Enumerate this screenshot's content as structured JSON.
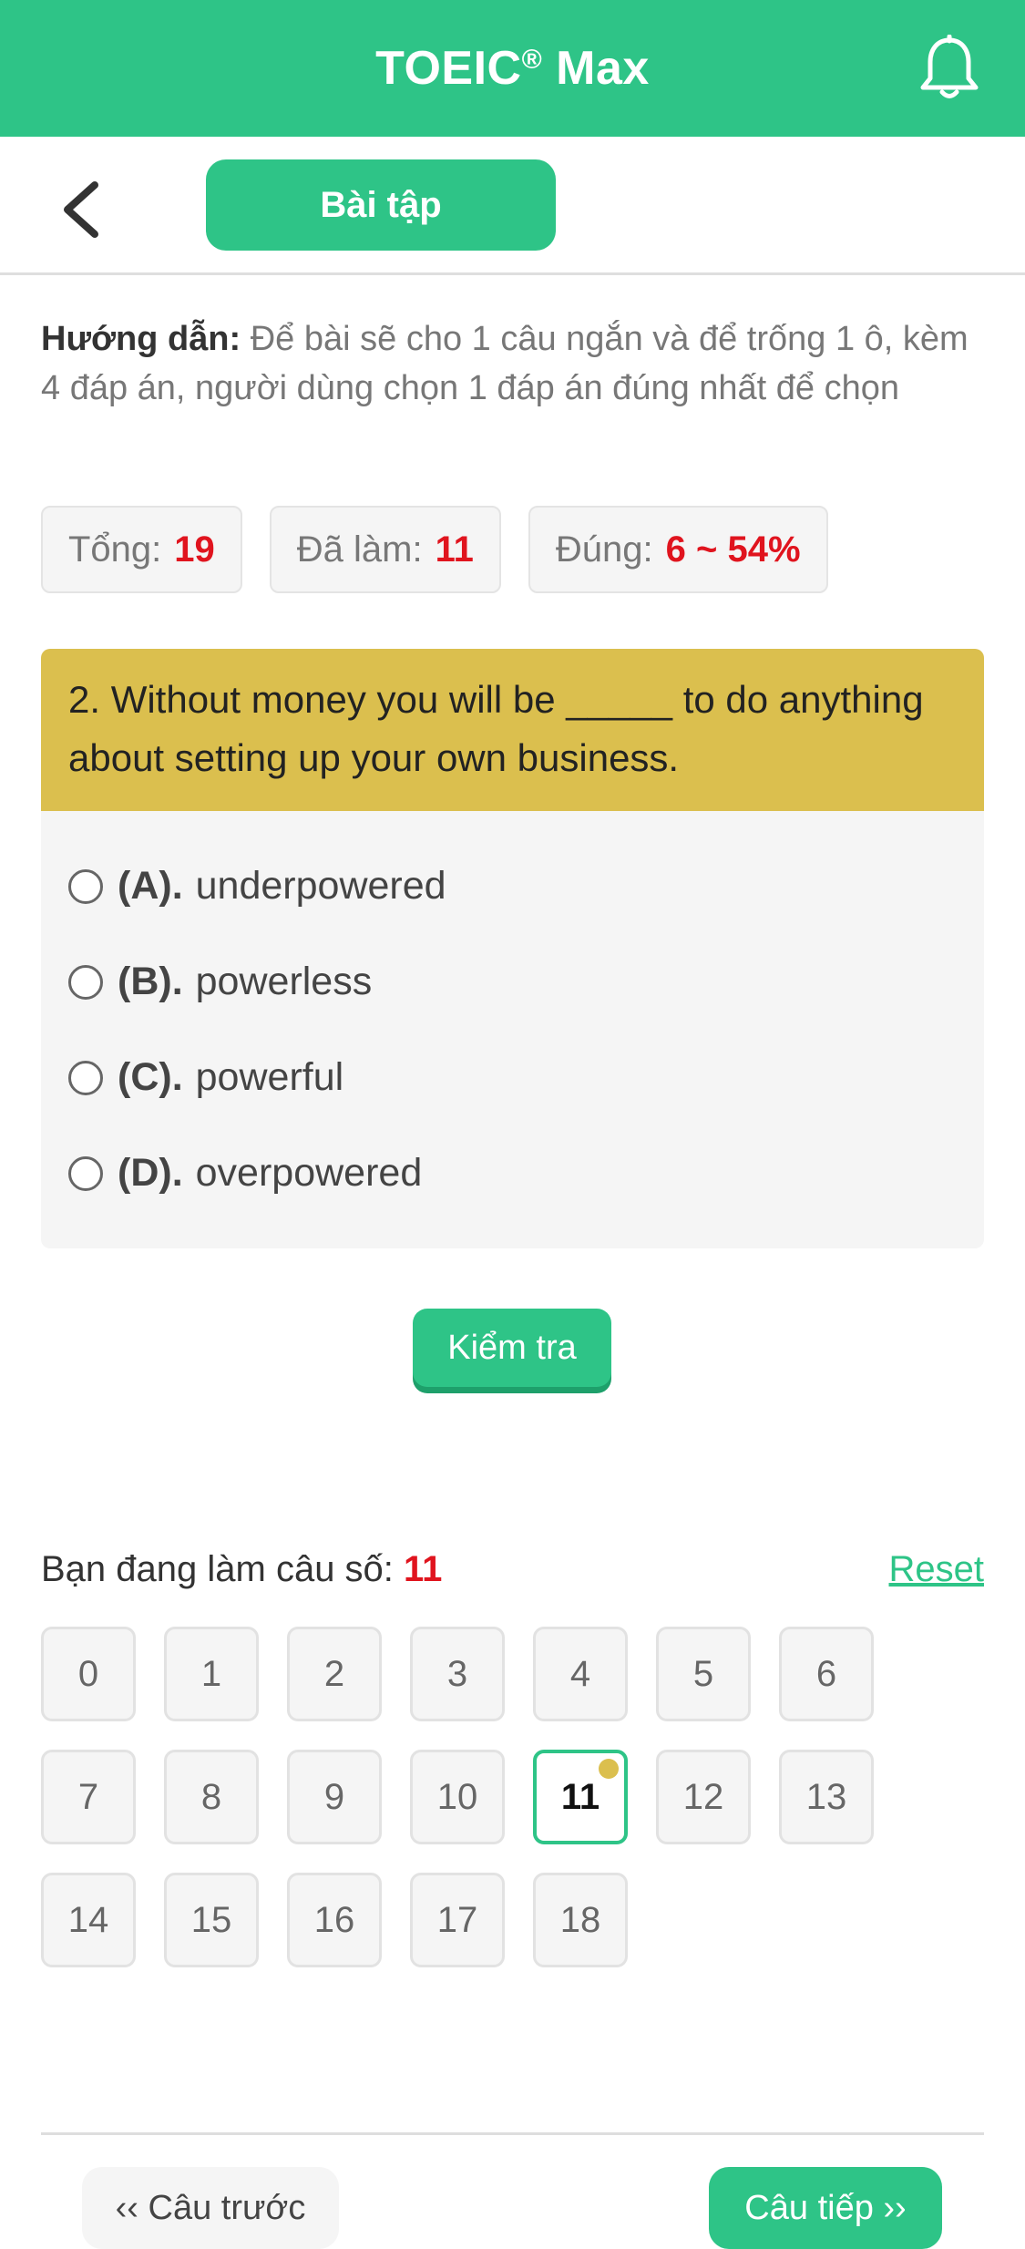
{
  "header": {
    "title": "TOEIC",
    "title_mark": "®",
    "title_suffix": " Max",
    "bell_icon": "bell-icon",
    "brand_color": "#2ec487"
  },
  "subbar": {
    "back_icon": "chevron-left-icon",
    "tab_label": "Bài tập"
  },
  "instructions": {
    "label": "Hướng dẫn:",
    "text": " Để bài sẽ cho 1 câu ngắn và để trống 1 ô, kèm 4 đáp án, người dùng chọn 1 đáp án đúng nhất để chọn"
  },
  "stats": [
    {
      "label": "Tổng:",
      "value": "19"
    },
    {
      "label": "Đã làm:",
      "value": "11"
    },
    {
      "label": "Đúng:",
      "value": "6 ~ 54%"
    }
  ],
  "question": {
    "text": "2. Without money you will be _____ to do anything about setting up your own business.",
    "options": [
      {
        "key": "(A).",
        "text": "underpowered"
      },
      {
        "key": "(B).",
        "text": "powerless"
      },
      {
        "key": "(C).",
        "text": "powerful"
      },
      {
        "key": "(D).",
        "text": "overpowered"
      }
    ],
    "header_color": "#dbbf4e"
  },
  "check_button": "Kiểm tra",
  "progress": {
    "label": "Bạn đang làm câu số:",
    "current": "11",
    "reset": "Reset"
  },
  "grid": [
    "0",
    "1",
    "2",
    "3",
    "4",
    "5",
    "6",
    "7",
    "8",
    "9",
    "10",
    "11",
    "12",
    "13",
    "14",
    "15",
    "16",
    "17",
    "18"
  ],
  "grid_active": "11",
  "nav": {
    "prev": "‹‹ Câu trước",
    "next": "Câu tiếp ››"
  }
}
